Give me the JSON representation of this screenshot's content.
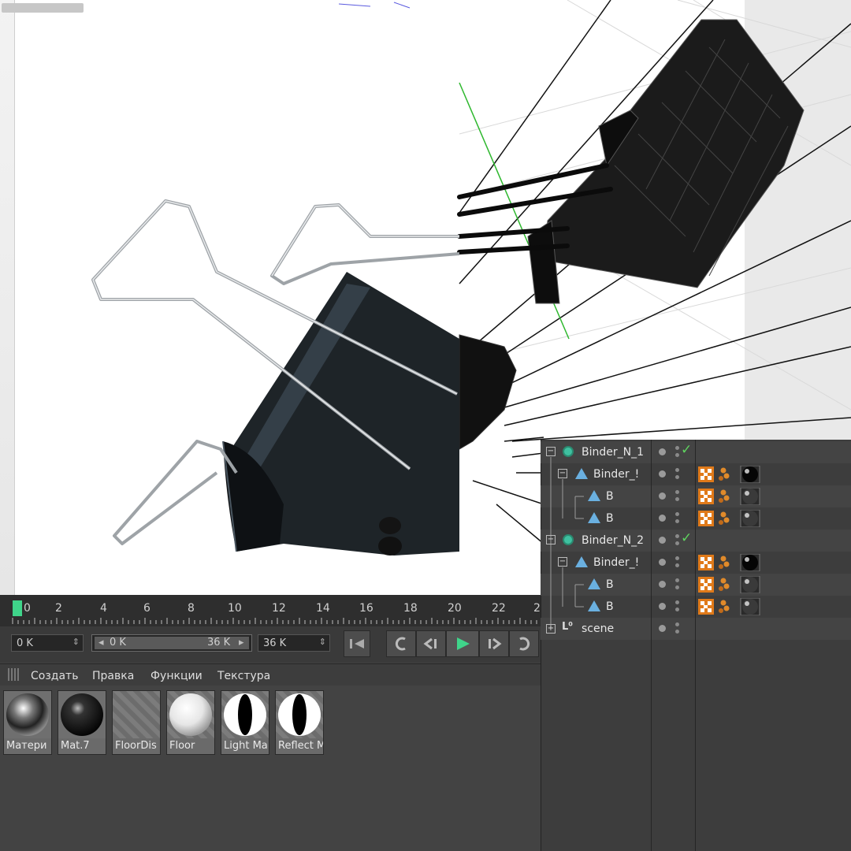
{
  "timeline": {
    "ticks": [
      "0",
      "2",
      "4",
      "6",
      "8",
      "10",
      "12",
      "14",
      "16",
      "18",
      "20",
      "22",
      "2"
    ],
    "current_frame": "0"
  },
  "transport": {
    "start_field": "0 K",
    "range_start": "0 K",
    "range_end": "36 K",
    "end_field": "36 K"
  },
  "material_menu": {
    "create": "Создать",
    "edit": "Правка",
    "functions": "Функции",
    "texture": "Текстура"
  },
  "materials": [
    {
      "name": "Матери",
      "type": "chrome"
    },
    {
      "name": "Mat.7",
      "type": "black-gloss"
    },
    {
      "name": "FloorDis",
      "type": "striped"
    },
    {
      "name": "Floor",
      "type": "white"
    },
    {
      "name": "Light Ma",
      "type": "light"
    },
    {
      "name": "Reflect M",
      "type": "light"
    }
  ],
  "objects": [
    {
      "name": "Binder_N_1",
      "kind": "null",
      "level": 0,
      "checked": true
    },
    {
      "name": "Binder_!",
      "kind": "mesh",
      "level": 1,
      "tags": true
    },
    {
      "name": "B",
      "kind": "mesh",
      "level": 2,
      "tags": true
    },
    {
      "name": "B",
      "kind": "mesh",
      "level": 2,
      "tags": true
    },
    {
      "name": "Binder_N_2",
      "kind": "null",
      "level": 0,
      "checked": true
    },
    {
      "name": "Binder_!",
      "kind": "mesh",
      "level": 1,
      "tags": true
    },
    {
      "name": "B",
      "kind": "mesh",
      "level": 2,
      "tags": true
    },
    {
      "name": "B",
      "kind": "mesh",
      "level": 2,
      "tags": true
    },
    {
      "name": "scene",
      "kind": "layer",
      "level": 0
    }
  ],
  "colors": {
    "accent_green": "#3fd48a",
    "check_green": "#5fd45f",
    "null_icon": "#3fc0a0",
    "mesh_icon": "#6ab0e0"
  }
}
